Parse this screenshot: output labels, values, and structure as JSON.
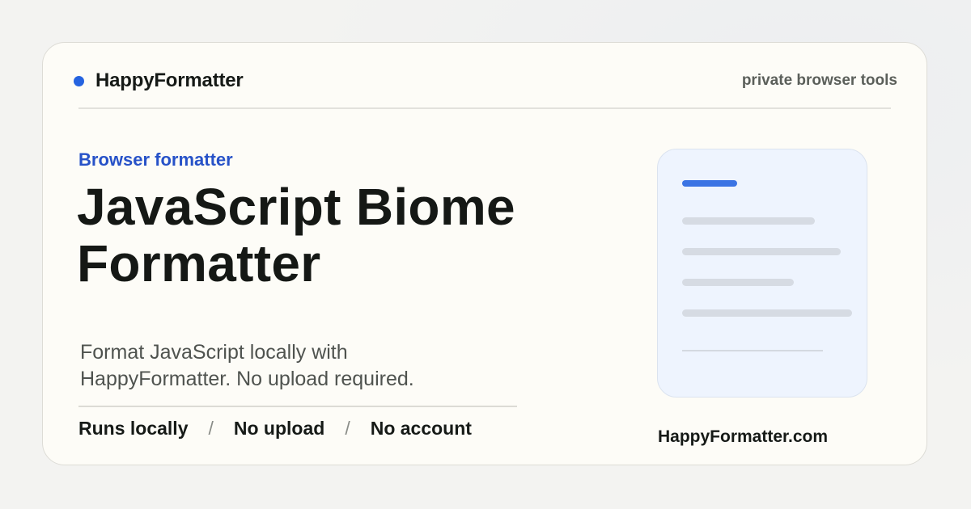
{
  "header": {
    "brand_name": "HappyFormatter",
    "tagline": "private browser tools"
  },
  "hero": {
    "eyebrow": "Browser formatter",
    "title_line1": "JavaScript Biome",
    "title_line2": "Formatter",
    "subtitle_line1": "Format JavaScript locally with",
    "subtitle_line2": "HappyFormatter. No upload required."
  },
  "features": {
    "items": [
      "Runs locally",
      "No upload",
      "No account"
    ],
    "separator": "/"
  },
  "footer": {
    "site": "HappyFormatter.com"
  },
  "colors": {
    "accent": "#2563e0",
    "eyebrow": "#2752c8",
    "card_background": "#fdfcf7",
    "doc_background": "#eef4fe"
  },
  "icons": {
    "brand_dot": "brand-dot-icon",
    "document": "document-icon"
  }
}
